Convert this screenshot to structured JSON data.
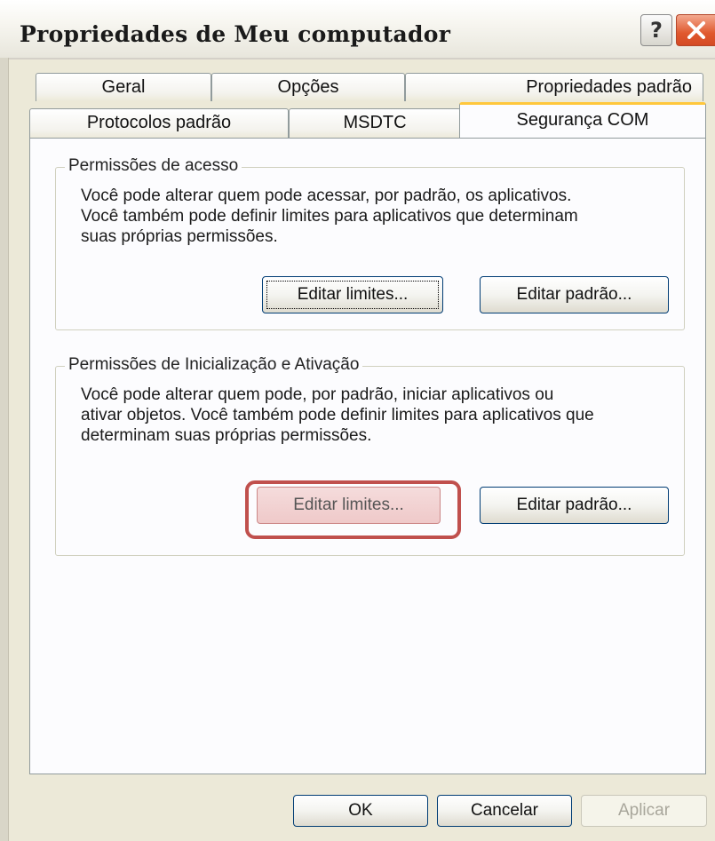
{
  "window": {
    "title": "Propriedades de Meu computador",
    "help_label": "?",
    "close_icon": "close-icon"
  },
  "tabs_row1": [
    {
      "label": "Geral"
    },
    {
      "label": "Opções"
    },
    {
      "label": "Propriedades padrão"
    }
  ],
  "tabs_row2": [
    {
      "label": "Protocolos padrão"
    },
    {
      "label": "MSDTC"
    },
    {
      "label": "Segurança COM",
      "active": true
    }
  ],
  "access_group": {
    "legend": "Permissões de acesso",
    "description": [
      "Você pode alterar quem pode acessar, por padrão, os aplicativos.",
      "Você também pode definir limites para aplicativos que determinam",
      "suas próprias permissões."
    ],
    "edit_limits_label": "Editar limites...",
    "edit_default_label": "Editar padrão..."
  },
  "launch_group": {
    "legend": "Permissões de Inicialização e Ativação",
    "description": [
      "Você pode alterar quem pode, por padrão, iniciar aplicativos ou",
      "ativar objetos. Você também pode definir limites para aplicativos que",
      "determinam suas próprias permissões."
    ],
    "edit_limits_label": "Editar limites...",
    "edit_default_label": "Editar padrão..."
  },
  "footer": {
    "ok_label": "OK",
    "cancel_label": "Cancelar",
    "apply_label": "Aplicar"
  },
  "colors": {
    "highlight_ring": "#c0504d",
    "active_tab_accent": "#ffc73c",
    "dialog_bg": "#ece9d8"
  }
}
